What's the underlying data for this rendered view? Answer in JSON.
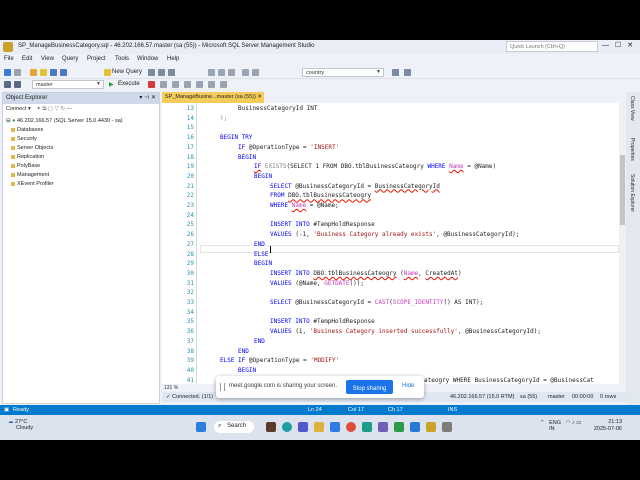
{
  "window": {
    "title": "SP_ManageBusinessCategory.sql - 46.202.166.57.master (sa (55)) - Microsoft SQL Server Management Studio",
    "quick_launch_placeholder": "Quick Launch (Ctrl+Q)",
    "controls": [
      "—",
      "☐",
      "✕"
    ]
  },
  "menu": [
    "File",
    "Edit",
    "View",
    "Query",
    "Project",
    "Tools",
    "Window",
    "Help"
  ],
  "toolbar": {
    "new_query": "New Query",
    "database_combo": "master",
    "execute": "Execute",
    "search_combo": "country"
  },
  "object_explorer": {
    "title": "Object Explorer",
    "connect": "Connect ▾",
    "server": "46.202.166.57 (SQL Server 15.0.4430 - sa)",
    "nodes": [
      "Databases",
      "Security",
      "Server Objects",
      "Replication",
      "PolyBase",
      "Management",
      "XEvent Profiler"
    ]
  },
  "editor": {
    "tab_label": "SP_ManageBusine...master (sa (55))",
    "zoom": "131 %",
    "line_numbers": [
      "13",
      "14",
      "15",
      "16",
      "17",
      "18",
      "19",
      "20",
      "21",
      "22",
      "23",
      "24",
      "25",
      "26",
      "27",
      "28",
      "29",
      "30",
      "31",
      "32",
      "33",
      "34",
      "35",
      "36",
      "37",
      "38",
      "39",
      "40",
      "41"
    ],
    "code": {
      "l13": "BusinessCategoryId INT",
      "l14": ");",
      "l16_kw": "BEGIN TRY",
      "l17_kw": "IF",
      "l17_var": "@OperationType =",
      "l17_str": "'INSERT'",
      "l18_kw": "BEGIN",
      "l19_kw": "IF",
      "l19_fn": "EXISTS",
      "l19_a": "(SELECT 1 FROM",
      "l19_tbl": "DBO.tblBusinessCateogry",
      "l19_b": "WHERE",
      "l19_name": "Name",
      "l19_c": "= @Name)",
      "l20_kw": "BEGIN",
      "l21_kw": "SELECT",
      "l21_a": "@BusinessCategoryId =",
      "l21_b": "BusinessCategoryId",
      "l22_kw": "FROM",
      "l22_tbl": "DBO.tblBusinessCateogry",
      "l23_kw": "WHERE",
      "l23_name": "Name",
      "l23_b": "= @Name;",
      "l25_kw": "INSERT INTO",
      "l25_a": "#TempHoldResponse",
      "l26_kw": "VALUES",
      "l26_a": "(-1,",
      "l26_str": "'Business Category already exists'",
      "l26_b": ", @BusinessCategoryId);",
      "l27_kw": "END",
      "l28_kw": "ELSE",
      "l29_kw": "BEGIN",
      "l30_kw": "INSERT INTO",
      "l30_tbl": "DBO.tblBusinessCateogry",
      "l30_a": "(",
      "l30_name": "Name",
      "l30_b": ",",
      "l30_c": "CreatedAt",
      "l30_d": ")",
      "l31_kw": "VALUES",
      "l31_a": "(@Name,",
      "l31_fn": "GETDATE",
      "l31_b": "());",
      "l33_kw": "SELECT",
      "l33_a": "@BusinessCategoryId =",
      "l33_fn": "CAST",
      "l33_b": "(",
      "l33_fn2": "SCOPE_IDENTITY",
      "l33_c": "() AS INT);",
      "l35_kw": "INSERT INTO",
      "l35_a": "#TempHoldResponse",
      "l36_kw": "VALUES",
      "l36_a": "(1,",
      "l36_str": "'Business Category inserted successfully'",
      "l36_b": ", @BusinessCategoryId);",
      "l37_kw": "END",
      "l38_kw": "END",
      "l39_kw": "ELSE IF",
      "l39_a": "@OperationType =",
      "l39_str": "'MODIFY'",
      "l40_kw": "BEGIN",
      "l41_a": "ateogry WHERE BusinessCategoryId = @BusinessCat"
    }
  },
  "share_banner": {
    "message": "meet.google.com is sharing your screen.",
    "stop": "Stop sharing",
    "hide": "Hide"
  },
  "query_status": {
    "connected": "✓ Connected. (1/1)",
    "server": "46.202.166.57 (15.0 RTM)",
    "user": "sa (55)",
    "db": "master",
    "time": "00:00:00",
    "rows": "0 rows"
  },
  "statusbar": {
    "ready": "Ready",
    "ln": "Ln 24",
    "col": "Col 17",
    "ch": "Ch 17",
    "ins": "INS"
  },
  "right_rail": [
    "Class View",
    "Properties",
    "Solution Explorer"
  ],
  "taskbar": {
    "temp": "27°C",
    "weather": "Cloudy",
    "search": "Search",
    "lang": "ENG",
    "region": "IN",
    "time": "21:13",
    "date": "2025-07-06"
  }
}
